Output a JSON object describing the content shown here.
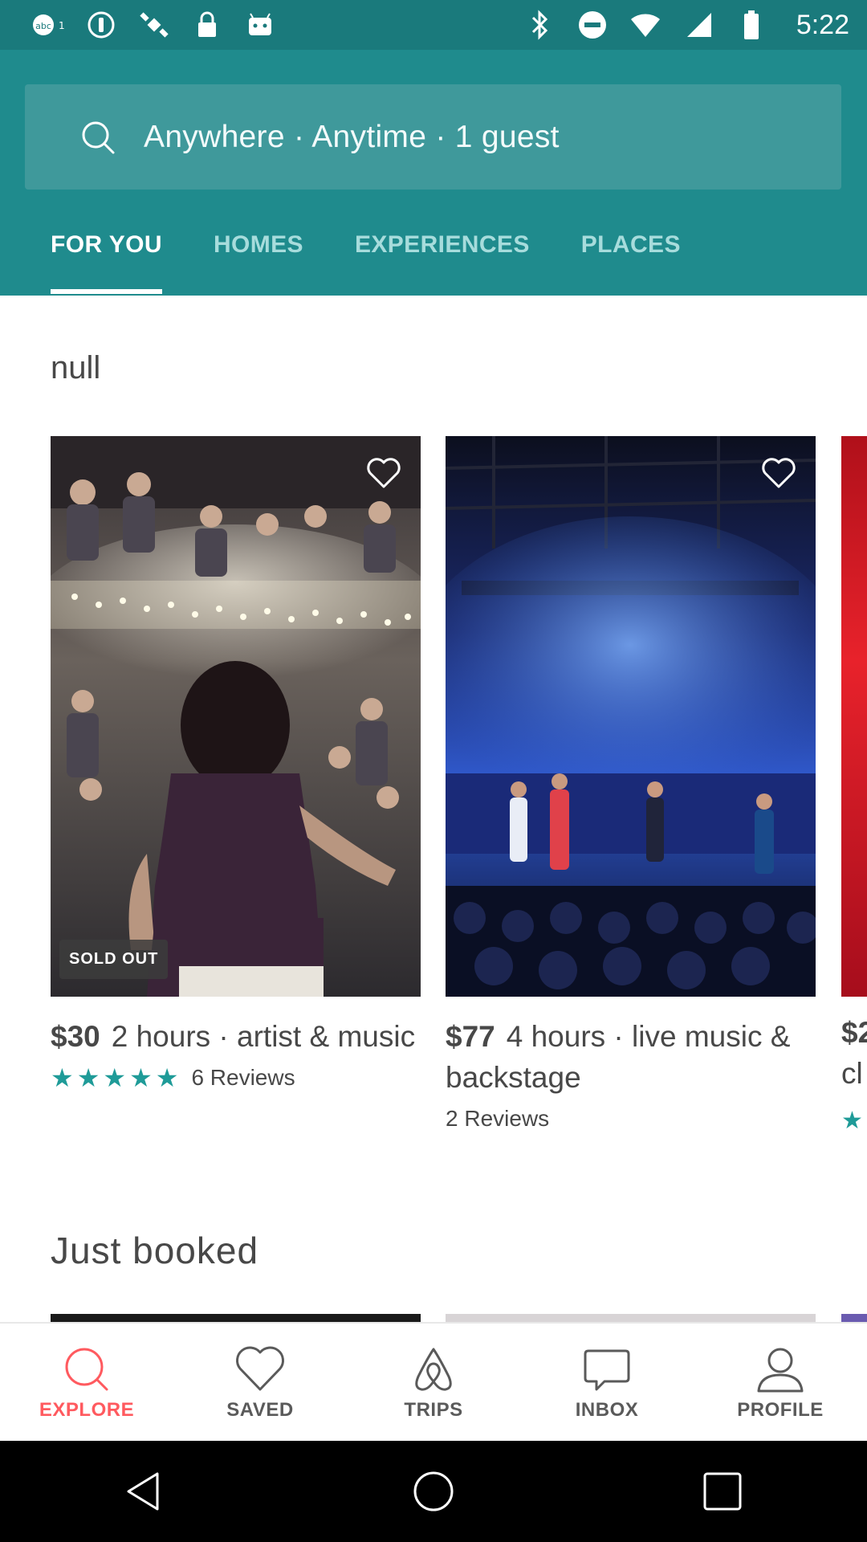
{
  "status_bar": {
    "time": "5:22",
    "icons_left": [
      "abc13-icon",
      "info-icon",
      "satellite-icon",
      "lock-icon",
      "android-icon"
    ],
    "icons_right": [
      "bluetooth-icon",
      "do-not-disturb-icon",
      "wifi-icon",
      "signal-icon",
      "battery-icon"
    ]
  },
  "search": {
    "text": "Anywhere · Anytime · 1 guest"
  },
  "tabs": [
    {
      "label": "FOR YOU",
      "active": true
    },
    {
      "label": "HOMES",
      "active": false
    },
    {
      "label": "EXPERIENCES",
      "active": false
    },
    {
      "label": "PLACES",
      "active": false
    }
  ],
  "section1": {
    "title": "null"
  },
  "cards": [
    {
      "price": "$30",
      "description": "2 hours · artist & music",
      "reviews": "6 Reviews",
      "rating_stars": 5,
      "badge": "SOLD OUT"
    },
    {
      "price": "$77",
      "description": "4 hours · live music & backstage",
      "reviews": "2 Reviews",
      "rating_stars": 0,
      "badge": ""
    }
  ],
  "partial_card": {
    "price": "$2",
    "desc": "cl"
  },
  "section2": {
    "title": "Just booked"
  },
  "bottom_nav": [
    {
      "label": "EXPLORE",
      "icon": "search-icon",
      "active": true
    },
    {
      "label": "SAVED",
      "icon": "heart-icon",
      "active": false
    },
    {
      "label": "TRIPS",
      "icon": "airbnb-logo-icon",
      "active": false
    },
    {
      "label": "INBOX",
      "icon": "chat-bubble-icon",
      "active": false
    },
    {
      "label": "PROFILE",
      "icon": "person-icon",
      "active": false
    }
  ],
  "colors": {
    "header": "#1f8b8d",
    "accent": "#ff5a5f",
    "star": "#1f9b98"
  }
}
